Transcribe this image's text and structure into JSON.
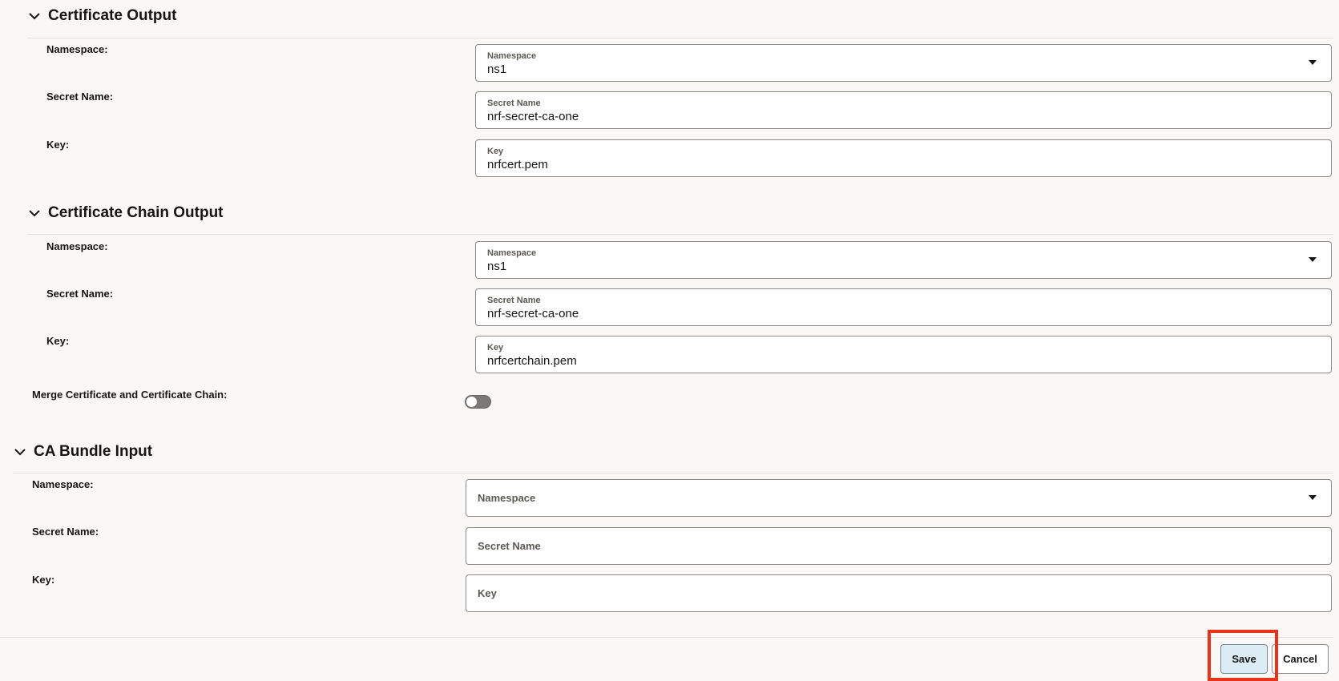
{
  "sections": {
    "cert_output": {
      "title": "Certificate Output",
      "namespace_label": "Namespace:",
      "namespace_field_label": "Namespace",
      "namespace_value": "ns1",
      "secret_label": "Secret Name:",
      "secret_field_label": "Secret Name",
      "secret_value": "nrf-secret-ca-one",
      "key_label": "Key:",
      "key_field_label": "Key",
      "key_value": "nrfcert.pem"
    },
    "chain_output": {
      "title": "Certificate Chain Output",
      "namespace_label": "Namespace:",
      "namespace_field_label": "Namespace",
      "namespace_value": "ns1",
      "secret_label": "Secret Name:",
      "secret_field_label": "Secret Name",
      "secret_value": "nrf-secret-ca-one",
      "key_label": "Key:",
      "key_field_label": "Key",
      "key_value": "nrfcertchain.pem"
    },
    "merge": {
      "label": "Merge Certificate and Certificate Chain:",
      "enabled": false
    },
    "ca_bundle": {
      "title": "CA Bundle Input",
      "namespace_label": "Namespace:",
      "namespace_placeholder": "Namespace",
      "secret_label": "Secret Name:",
      "secret_placeholder": "Secret Name",
      "key_label": "Key:",
      "key_placeholder": "Key"
    }
  },
  "footer": {
    "save_label": "Save",
    "cancel_label": "Cancel"
  },
  "colors": {
    "highlight": "#e8321a",
    "save_bg": "#dcecf4"
  }
}
